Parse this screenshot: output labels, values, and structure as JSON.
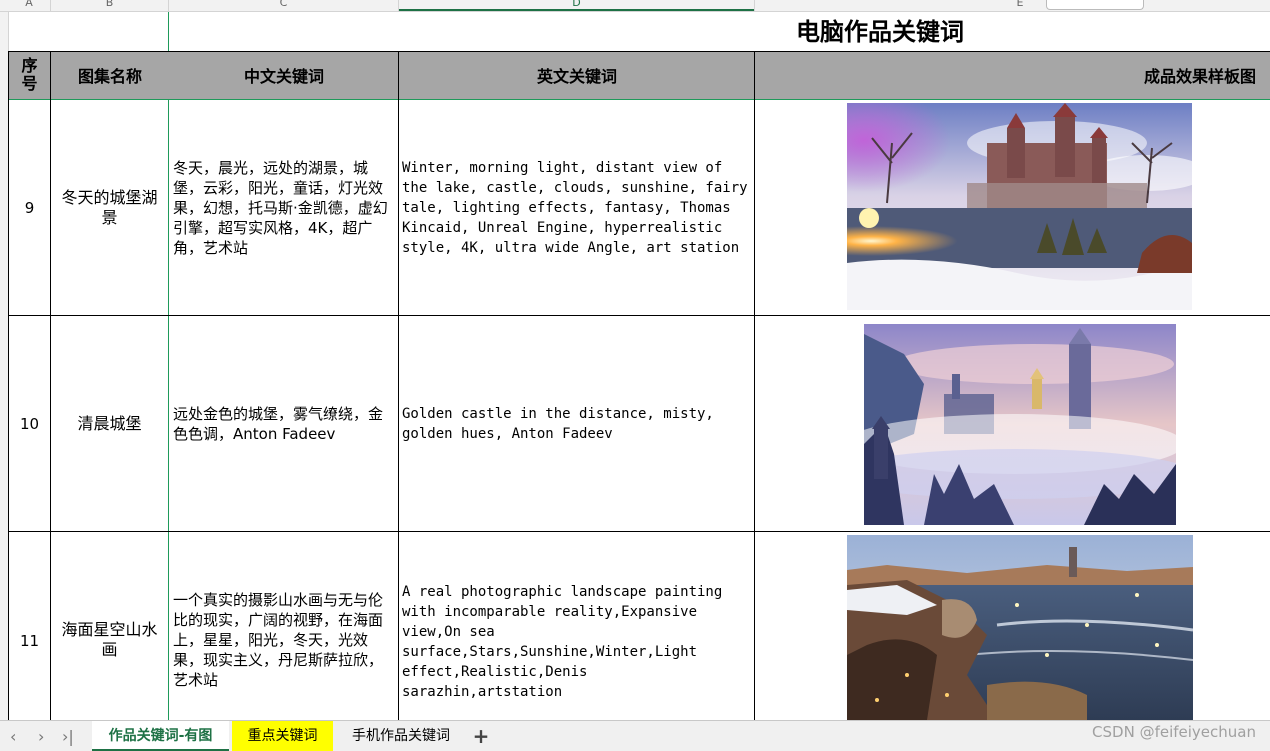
{
  "columns": [
    "A",
    "B",
    "C",
    "D",
    "E"
  ],
  "sheet_title": "电脑作品关键词",
  "headers": {
    "seq": "序\n号",
    "name": "图集名称",
    "cn": "中文关键词",
    "en": "英文关键词",
    "sample": "成品效果样板图"
  },
  "rows": [
    {
      "num": "9",
      "name": "冬天的城堡湖景",
      "cn": "冬天，晨光，远处的湖景，城堡，云彩，阳光，童话，灯光效果，幻想，托马斯·金凯德，虚幻引擎，超写实风格，4K，超广角，艺术站",
      "en": "Winter, morning light, distant view of the lake, castle, clouds, sunshine, fairy tale, lighting effects, fantasy, Thomas Kincaid, Unreal Engine, hyperrealistic style, 4K, ultra wide Angle, art station"
    },
    {
      "num": "10",
      "name": "清晨城堡",
      "cn": "远处金色的城堡，雾气缭绕，金色色调，Anton Fadeev",
      "en": "Golden castle in the distance, misty, golden hues, Anton Fadeev"
    },
    {
      "num": "11",
      "name": "海面星空山水画",
      "cn": "一个真实的摄影山水画与无与伦比的现实，广阔的视野，在海面上，星星，阳光，冬天，光效果，现实主义，丹尼斯萨拉欣，艺术站",
      "en": "A real photographic landscape painting with incomparable reality,Expansive view,On sea surface,Stars,Sunshine,Winter,Light effect,Realistic,Denis sarazhin,artstation"
    }
  ],
  "tabs": [
    "作品关键词-有图",
    "重点关键词",
    "手机作品关键词"
  ],
  "add_tab": "+",
  "nav": [
    "‹",
    "›",
    "›|"
  ],
  "watermark": "CSDN @feifeiyechuan",
  "colors": {
    "header_bg": "#a6a6a6",
    "active_tab": "#1e7145",
    "highlight_tab": "#ffff00"
  }
}
